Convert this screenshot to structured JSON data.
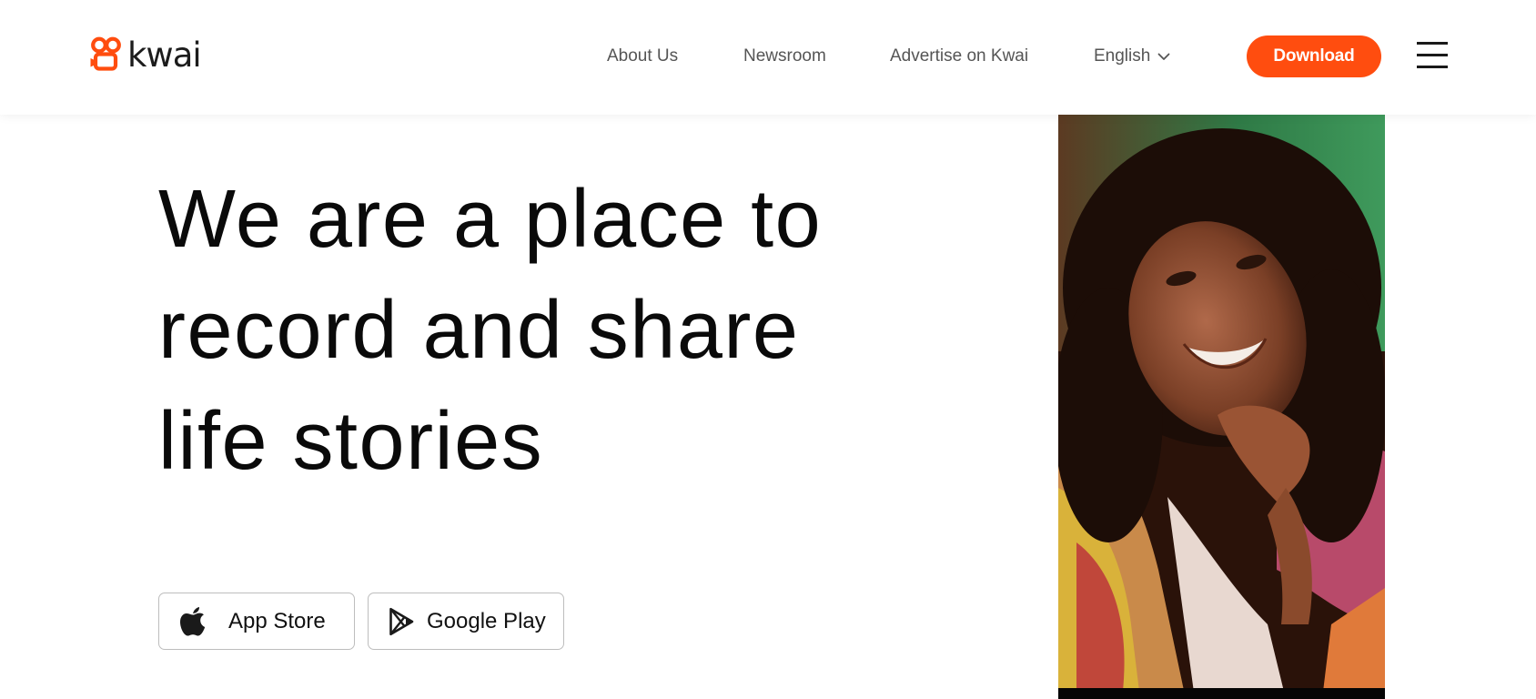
{
  "brand": {
    "name": "kwai",
    "accent_color": "#ff4d0f"
  },
  "header": {
    "logo_icon": "kwai-logo-icon",
    "nav": [
      {
        "label": "About Us"
      },
      {
        "label": "Newsroom"
      },
      {
        "label": "Advertise on Kwai"
      }
    ],
    "language": {
      "label": "English",
      "icon": "chevron-down-icon"
    },
    "download_label": "Download",
    "menu_icon": "hamburger-menu-icon"
  },
  "hero": {
    "headline_lines": [
      "We are a place to",
      "record and share",
      "life stories"
    ],
    "stores": [
      {
        "label": "App Store",
        "icon": "apple-icon"
      },
      {
        "label": "Google Play",
        "icon": "google-play-icon"
      }
    ],
    "image": "woman-smiling-photo"
  }
}
